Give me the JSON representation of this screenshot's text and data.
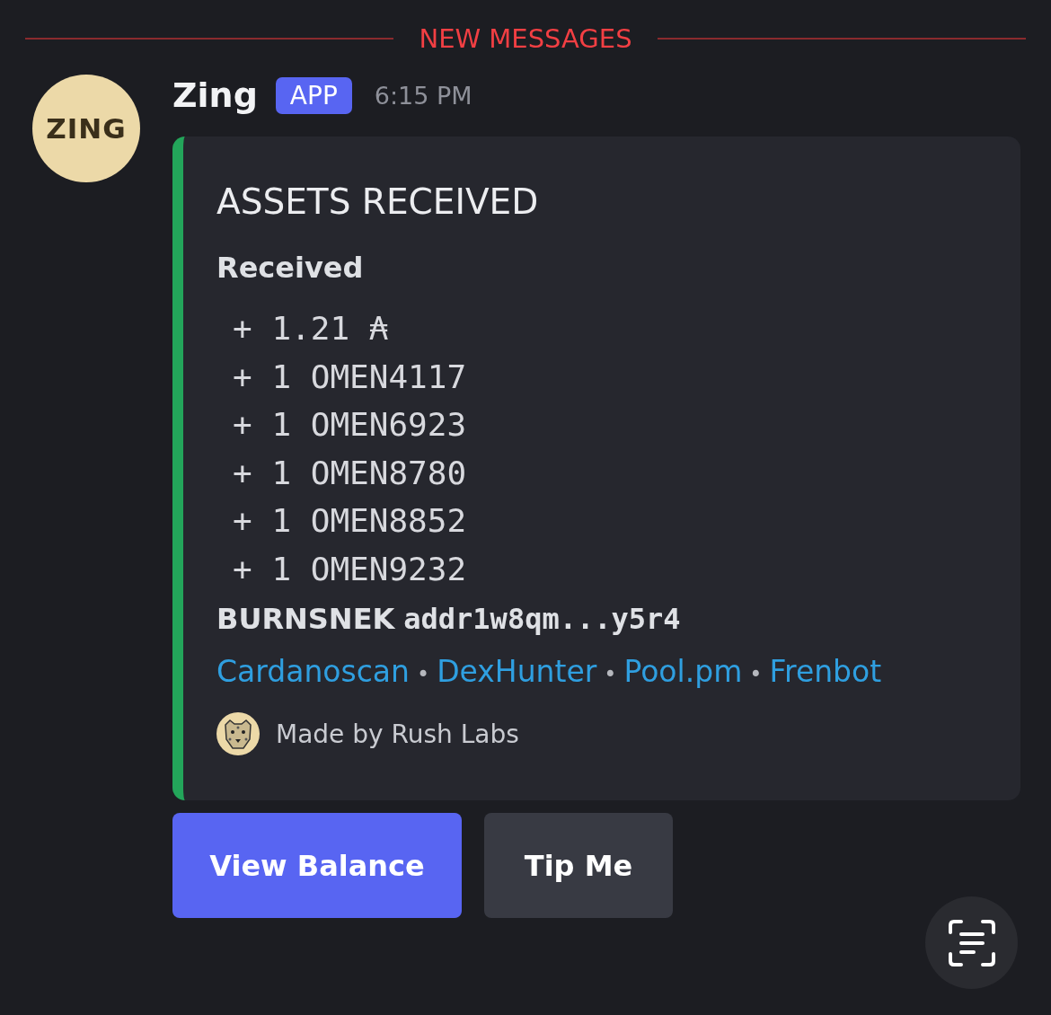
{
  "divider": {
    "label": "NEW MESSAGES"
  },
  "message": {
    "avatar_text": "ZING",
    "author": "Zing",
    "badge": "APP",
    "time": "6:15 PM"
  },
  "embed": {
    "color": "#23a55a",
    "title": "ASSETS RECEIVED",
    "field_name": "Received",
    "lines": [
      {
        "sign": "+",
        "text": "1.21 ₳"
      },
      {
        "sign": "+",
        "text": "1 OMEN4117"
      },
      {
        "sign": "+",
        "text": "1 OMEN6923"
      },
      {
        "sign": "+",
        "text": "1 OMEN8780"
      },
      {
        "sign": "+",
        "text": "1 OMEN8852"
      },
      {
        "sign": "+",
        "text": "1 OMEN9232"
      }
    ],
    "address": {
      "label": "BURNSNEK",
      "value": "addr1w8qm...y5r4"
    },
    "links": [
      "Cardanoscan",
      "DexHunter",
      "Pool.pm",
      "Frenbot"
    ],
    "separator": "•",
    "footer": "Made by Rush Labs"
  },
  "buttons": [
    {
      "label": "View Balance",
      "kind": "primary"
    },
    {
      "label": "Tip Me",
      "kind": "secondary"
    }
  ]
}
